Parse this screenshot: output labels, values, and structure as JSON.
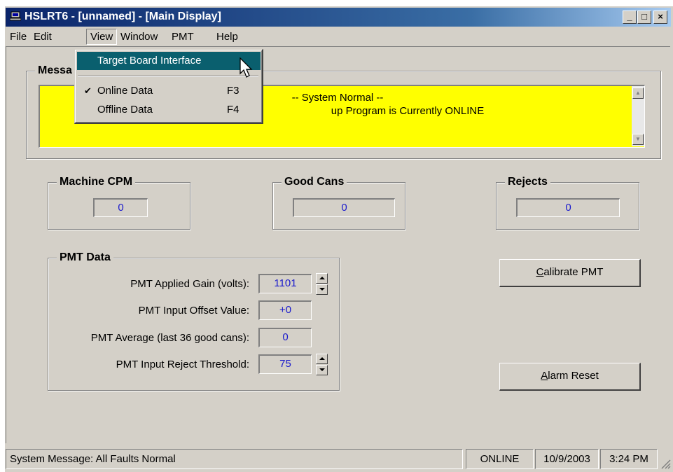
{
  "window": {
    "title": "HSLRT6 - [unnamed] - [Main Display]",
    "controls": [
      "_",
      "□",
      "×"
    ]
  },
  "menu": {
    "items": [
      "File",
      "Edit",
      "View",
      "Window",
      "PMT",
      "Help"
    ],
    "active": "View"
  },
  "view_menu": {
    "items": [
      {
        "label": "Target Board Interface",
        "shortcut": "",
        "checked": false,
        "highlighted": true
      },
      {
        "label": "Online Data",
        "shortcut": "F3",
        "checked": true,
        "highlighted": false
      },
      {
        "label": "Offline Data",
        "shortcut": "F4",
        "checked": false,
        "highlighted": false
      }
    ]
  },
  "messages": {
    "title_visible": "Messa",
    "line1": "-- System Normal --",
    "line2_visible": "up Program is Currently ONLINE",
    "background_color": "#ffff00"
  },
  "counters": {
    "machine_cpm": {
      "label": "Machine CPM",
      "value": "0"
    },
    "good_cans": {
      "label": "Good Cans",
      "value": "0"
    },
    "rejects": {
      "label": "Rejects",
      "value": "0"
    }
  },
  "pmt_data": {
    "title": "PMT Data",
    "applied_gain": {
      "label": "PMT Applied Gain (volts):",
      "value": "1101"
    },
    "input_offset": {
      "label": "PMT Input Offset Value:",
      "value": "+0"
    },
    "average": {
      "label": "PMT Average (last 36 good cans):",
      "value": "0"
    },
    "reject_threshold": {
      "label": "PMT Input Reject Threshold:",
      "value": "75"
    }
  },
  "buttons": {
    "calibrate_mnemonic": "C",
    "calibrate_rest": "alibrate PMT",
    "alarm_mnemonic": "A",
    "alarm_rest": "larm Reset"
  },
  "statusbar": {
    "message": "System Message:  All Faults Normal",
    "mode": "ONLINE",
    "date": "10/9/2003",
    "time": "3:24 PM"
  },
  "colors": {
    "title_active": "#0a246a",
    "menu_highlight": "#0a5f6e",
    "value_text": "#1a1acc",
    "face": "#d4d0c8"
  }
}
